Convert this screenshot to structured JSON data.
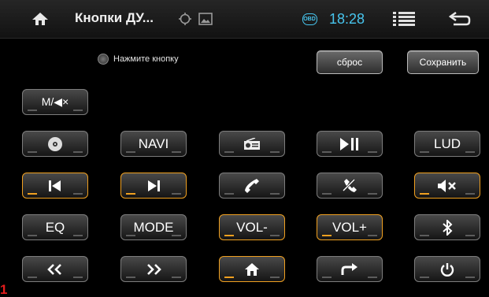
{
  "status_bar": {
    "title": "Кнопки ДУ...",
    "time": "18:28",
    "obd_badge": "OBD",
    "colors": {
      "time": "#47c5ee",
      "accent": "#f0a020"
    }
  },
  "assign": {
    "prompt": "Нажмите кнопку",
    "reset_label": "сброс",
    "save_label": "Сохранить"
  },
  "keys": {
    "mute_mode": {
      "label": "M/◀×",
      "active": false
    },
    "dvd": {
      "icon": "disc-icon",
      "active": false
    },
    "navi": {
      "label": "NAVI",
      "active": false
    },
    "radio": {
      "icon": "radio-icon",
      "active": false
    },
    "play_pause": {
      "icon": "play-pause-icon",
      "active": false
    },
    "lud": {
      "label": "LUD",
      "active": false
    },
    "prev": {
      "icon": "previous-track-icon",
      "active": true
    },
    "next": {
      "icon": "next-track-icon",
      "active": true
    },
    "call": {
      "icon": "phone-answer-icon",
      "active": false
    },
    "hangup": {
      "icon": "phone-hangup-icon",
      "active": false
    },
    "mute": {
      "icon": "mute-icon",
      "active": true
    },
    "eq": {
      "label": "EQ",
      "active": false
    },
    "mode": {
      "label": "MODE",
      "active": false
    },
    "vol_down": {
      "label": "VOL-",
      "active": true
    },
    "vol_up": {
      "label": "VOL+",
      "active": true
    },
    "bluetooth": {
      "icon": "bluetooth-icon",
      "active": false
    },
    "rewind": {
      "icon": "rewind-icon",
      "active": false
    },
    "forward": {
      "icon": "fast-forward-icon",
      "active": false
    },
    "home": {
      "icon": "home-icon",
      "active": true
    },
    "back": {
      "icon": "return-icon",
      "active": false
    },
    "power": {
      "icon": "power-icon",
      "active": false
    }
  },
  "corner_marker": "1"
}
